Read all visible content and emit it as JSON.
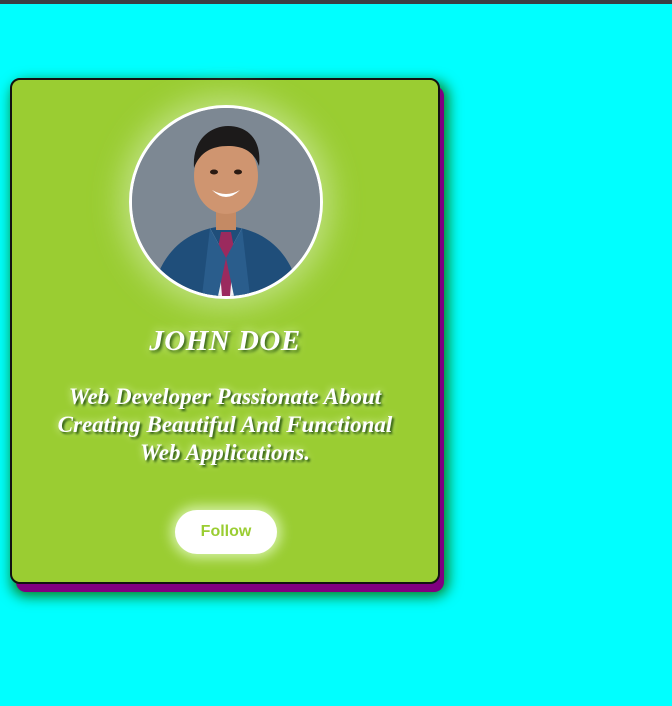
{
  "profile": {
    "name": "JOHN DOE",
    "bio": "Web Developer Passionate About Creating Beautiful And Functional Web Applications.",
    "follow_label": "Follow",
    "avatar_alt": "profile-photo"
  },
  "colors": {
    "page_background": "#00ffff",
    "card_background": "#9acd32",
    "card_offset_shadow": "#800080",
    "card_glow": "#0a7a12",
    "button_text": "#9acd32",
    "text": "#ffffff"
  }
}
